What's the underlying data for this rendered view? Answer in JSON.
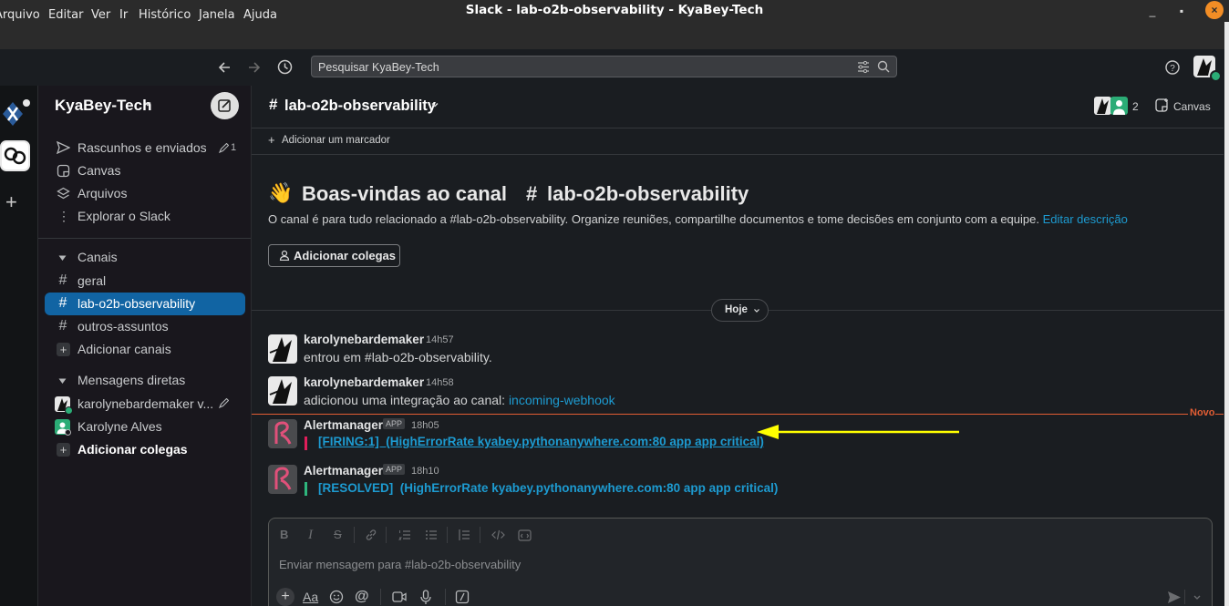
{
  "os": {
    "window_title": "Slack - lab-o2b-observability - KyaBey-Tech",
    "minimize": "_",
    "maximize": "▪",
    "close": "×"
  },
  "menu": [
    "Arquivo",
    "Editar",
    "Ver",
    "Ir",
    "Histórico",
    "Janela",
    "Ajuda"
  ],
  "search": {
    "placeholder": "Pesquisar KyaBey-Tech"
  },
  "workspace": {
    "name": "KyaBey-Tech"
  },
  "sidebar": {
    "items": [
      {
        "label": "Rascunhos e enviados",
        "count": "1"
      },
      {
        "label": "Canvas"
      },
      {
        "label": "Arquivos"
      },
      {
        "label": "Explorar o Slack"
      }
    ],
    "channels_header": "Canais",
    "channels": [
      "geral",
      "lab-o2b-observability",
      "outros-assuntos"
    ],
    "add_channels": "Adicionar canais",
    "dm_header": "Mensagens diretas",
    "dms": [
      "karolynebardemaker  v...",
      "Karolyne Alves"
    ],
    "add_colleagues": "Adicionar colegas"
  },
  "channel": {
    "name": "lab-o2b-observability",
    "member_count": "2",
    "canvas_label": "Canvas",
    "bookmark_label": "Adicionar um marcador",
    "welcome_emoji": "👋",
    "welcome_title": "Boas-vindas ao canal",
    "welcome_hash": "#",
    "welcome_channel": "lab-o2b-observability",
    "description": "O canal é para tudo relacionado a #lab-o2b-observability. Organize reuniões, compartilhe documentos e tome decisões em conjunto com a equipe.",
    "edit_description": "Editar descrição",
    "add_colleagues_button": "Adicionar colegas",
    "date_divider": "Hoje",
    "new_label": "Novo"
  },
  "messages": [
    {
      "author": "karolynebardemaker",
      "time": "14h57",
      "text": "entrou em #lab-o2b-observability."
    },
    {
      "author": "karolynebardemaker",
      "time": "14h58",
      "text": "adicionou uma integração ao canal: ",
      "link": "incoming-webhook"
    },
    {
      "author": "Alertmanager",
      "badge": "APP",
      "time": "18h05",
      "attachment": "[FIRING:1]  (HighErrorRate kyabey.pythonanywhere.com:80 app app critical)",
      "bar_color": "#e01e5a"
    },
    {
      "author": "Alertmanager",
      "badge": "APP",
      "time": "18h10",
      "attachment": "[RESOLVED]  (HighErrorRate kyabey.pythonanywhere.com:80 app app critical)",
      "bar_color": "#2eb67d"
    }
  ],
  "composer": {
    "placeholder": "Enviar mensagem para #lab-o2b-observability"
  },
  "colors": {
    "accent": "#1164a3",
    "link": "#1d9bd1",
    "new_divider": "#e25d33",
    "arrow": "#ffff00",
    "online": "#2bac76"
  }
}
